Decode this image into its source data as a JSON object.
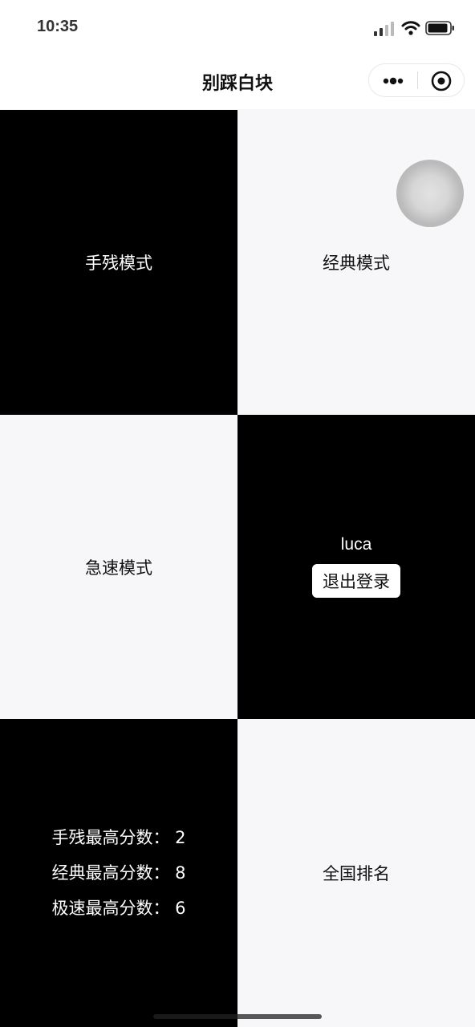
{
  "status_bar": {
    "time": "10:35",
    "icons": [
      "signal-icon",
      "wifi-icon",
      "battery-icon"
    ]
  },
  "nav": {
    "title": "别踩白块",
    "capsule_icons": [
      "more-icon",
      "close-mini-program-icon"
    ]
  },
  "tiles": {
    "handicap_mode": "手残模式",
    "classic_mode": "经典模式",
    "speed_mode": "急速模式",
    "national_ranking": "全国排名"
  },
  "account": {
    "username": "luca",
    "logout_label": "退出登录"
  },
  "scores": {
    "handicap": "手残最高分数：  2",
    "classic": "经典最高分数：  8",
    "speed": "极速最高分数：  6"
  },
  "colors": {
    "tile_black": "#000000",
    "tile_white": "#f7f7f9",
    "bar_background": "#ffffff"
  }
}
